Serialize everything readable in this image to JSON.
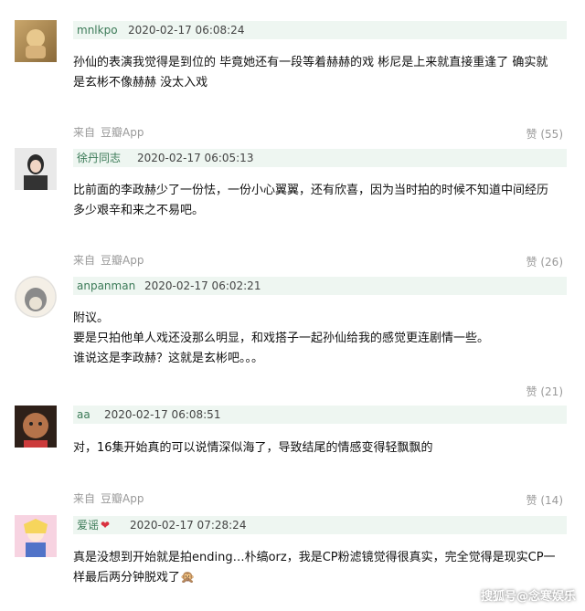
{
  "comments": [
    {
      "user": "mnlkpo",
      "time": "2020-02-17 06:08:24",
      "lines": [
        "孙仙的表演我觉得是到位的 毕竟她还有一段等着赫赫的戏 彬尼是上来就直接重逢了 确实就",
        "是玄彬不像赫赫 没太入戏"
      ],
      "source": "来自",
      "app": "豆瓣App",
      "likes": "赞 (55)"
    },
    {
      "user": "徐丹同志",
      "time": "2020-02-17 06:05:13",
      "lines": [
        "比前面的李政赫少了一份怯，一份小心翼翼，还有欣喜，因为当时拍的时候不知道中间经历",
        "多少艰辛和来之不易吧。"
      ],
      "source": "来自",
      "app": "豆瓣App",
      "likes": "赞 (26)"
    },
    {
      "user": "anpanman",
      "time": "2020-02-17 06:02:21",
      "lines": [
        "附议。",
        "要是只拍他单人戏还没那么明显，和戏搭子一起孙仙给我的感觉更连剧情一些。",
        "谁说这是李政赫？这就是玄彬吧。。。"
      ],
      "source": "",
      "app": "",
      "likes": "赞 (21)"
    },
    {
      "user": "aa",
      "time": "2020-02-17 06:08:51",
      "lines": [
        "对，16集开始真的可以说情深似海了，导致结尾的情感变得轻飘飘的"
      ],
      "source": "来自",
      "app": "豆瓣App",
      "likes": "赞 (14)"
    },
    {
      "user": "爱谣",
      "time": "2020-02-17 07:28:24",
      "lines": [
        "真是没想到开始就是拍ending…朴缟orz，我是CP粉滤镜觉得很真实，完全觉得是现实CP一",
        "样最后两分钟脱戏了🙊"
      ],
      "source": "",
      "app": "",
      "likes": ""
    }
  ],
  "watermark": "搜狐号@念寒娱乐",
  "colors": {
    "header_bg": "#eef6f1",
    "username": "#3b7a57",
    "meta": "#999999"
  },
  "icons": [
    "dog-avatar",
    "girl-avatar",
    "totoro-avatar",
    "poodle-avatar",
    "sailor-moon-avatar",
    "heart-icon"
  ]
}
